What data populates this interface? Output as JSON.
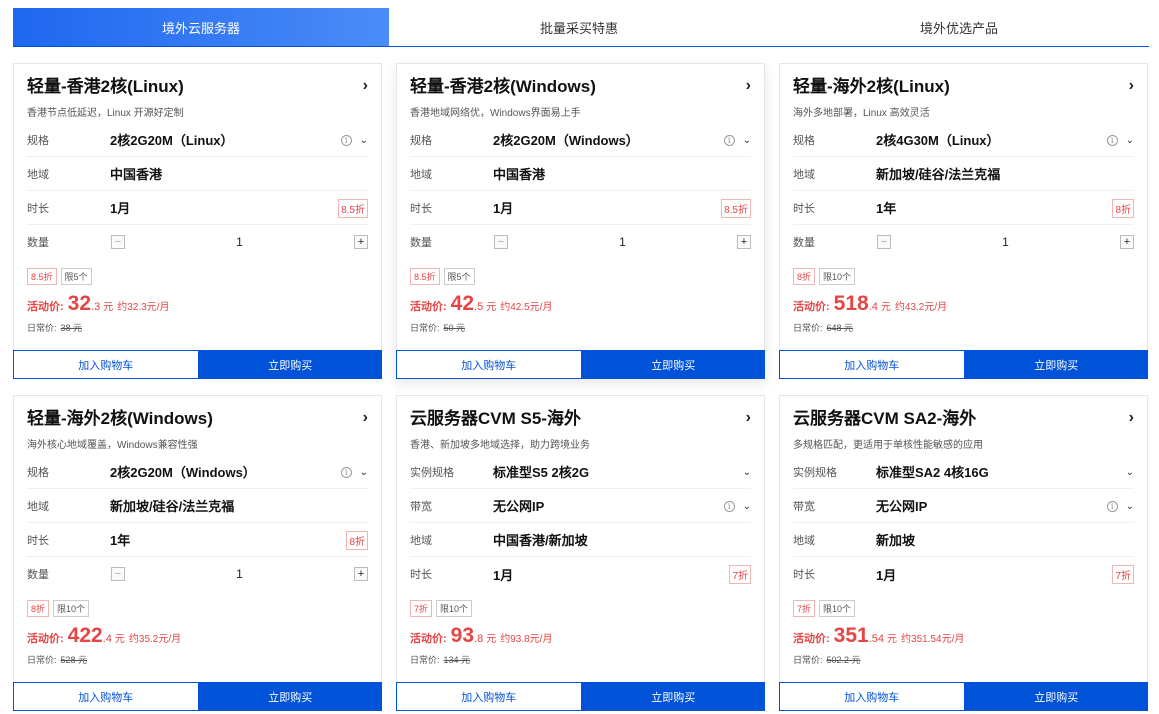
{
  "tabs": [
    {
      "label": "境外云服务器",
      "active": true
    },
    {
      "label": "批量采买特惠",
      "active": false
    },
    {
      "label": "境外优选产品",
      "active": false
    }
  ],
  "common": {
    "arrow": "›",
    "cart_label": "加入购物车",
    "buy_label": "立即购买",
    "price_label": "活动价:",
    "price_unit": "元",
    "orig_label": "日常价:",
    "stepper_minus": "−",
    "stepper_plus": "+",
    "info": "i",
    "chevron": "⌄"
  },
  "cards": [
    {
      "title": "轻量-香港2核(Linux)",
      "subtitle": "香港节点低延迟，Linux 开源好定制",
      "rows": [
        {
          "label": "规格",
          "value": "2核2G20M（Linux）",
          "right": "info-chevron"
        },
        {
          "label": "地域",
          "value": "中国香港"
        },
        {
          "label": "时长",
          "value": "1月",
          "badge": "8.5折"
        },
        {
          "label": "数量",
          "stepper": "1"
        }
      ],
      "chips": [
        "8.5折",
        "限5个"
      ],
      "price_int": "32",
      "price_dec": ".3",
      "price_month": "约32.3元/月",
      "orig_price": "38 元"
    },
    {
      "title": "轻量-香港2核(Windows)",
      "subtitle": "香港地域网络优，Windows界面易上手",
      "rows": [
        {
          "label": "规格",
          "value": "2核2G20M（Windows）",
          "right": "info-chevron"
        },
        {
          "label": "地域",
          "value": "中国香港"
        },
        {
          "label": "时长",
          "value": "1月",
          "badge": "8.5折"
        },
        {
          "label": "数量",
          "stepper": "1"
        }
      ],
      "chips": [
        "8.5折",
        "限5个"
      ],
      "price_int": "42",
      "price_dec": ".5",
      "price_month": "约42.5元/月",
      "orig_price": "50 元"
    },
    {
      "title": "轻量-海外2核(Linux)",
      "subtitle": "海外多地部署，Linux 高效灵活",
      "rows": [
        {
          "label": "规格",
          "value": "2核4G30M（Linux）",
          "right": "info-chevron"
        },
        {
          "label": "地域",
          "value": "新加坡/硅谷/法兰克福"
        },
        {
          "label": "时长",
          "value": "1年",
          "badge": "8折"
        },
        {
          "label": "数量",
          "stepper": "1"
        }
      ],
      "chips": [
        "8折",
        "限10个"
      ],
      "price_int": "518",
      "price_dec": ".4",
      "price_month": "约43.2元/月",
      "orig_price": "648 元"
    },
    {
      "title": "轻量-海外2核(Windows)",
      "subtitle": "海外核心地域覆盖，Windows兼容性强",
      "rows": [
        {
          "label": "规格",
          "value": "2核2G20M（Windows）",
          "right": "info-chevron"
        },
        {
          "label": "地域",
          "value": "新加坡/硅谷/法兰克福"
        },
        {
          "label": "时长",
          "value": "1年",
          "badge": "8折"
        },
        {
          "label": "数量",
          "stepper": "1"
        }
      ],
      "chips": [
        "8折",
        "限10个"
      ],
      "price_int": "422",
      "price_dec": ".4",
      "price_month": "约35.2元/月",
      "orig_price": "528 元"
    },
    {
      "title": "云服务器CVM S5-海外",
      "subtitle": "香港、新加坡多地域选择，助力跨境业务",
      "rows": [
        {
          "label": "实例规格",
          "value": "标准型S5 2核2G",
          "right": "chevron"
        },
        {
          "label": "带宽",
          "value": "无公网IP",
          "right": "info-chevron"
        },
        {
          "label": "地域",
          "value": "中国香港/新加坡"
        },
        {
          "label": "时长",
          "value": "1月",
          "badge": "7折"
        }
      ],
      "chips": [
        "7折",
        "限10个"
      ],
      "price_int": "93",
      "price_dec": ".8",
      "price_month": "约93.8元/月",
      "orig_price": "134 元"
    },
    {
      "title": "云服务器CVM SA2-海外",
      "subtitle": "多规格匹配，更适用于单核性能敏感的应用",
      "rows": [
        {
          "label": "实例规格",
          "value": "标准型SA2 4核16G",
          "right": "chevron"
        },
        {
          "label": "带宽",
          "value": "无公网IP",
          "right": "info-chevron"
        },
        {
          "label": "地域",
          "value": "新加坡"
        },
        {
          "label": "时长",
          "value": "1月",
          "badge": "7折"
        }
      ],
      "chips": [
        "7折",
        "限10个"
      ],
      "price_int": "351",
      "price_dec": ".54",
      "price_month": "约351.54元/月",
      "orig_price": "502.2 元"
    }
  ]
}
